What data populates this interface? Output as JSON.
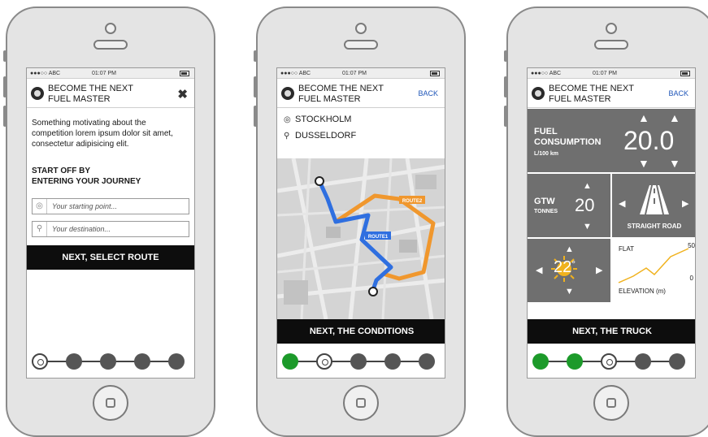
{
  "statusbar": {
    "signal": "●●●○○ ABC",
    "time": "01:07 PM"
  },
  "common": {
    "title_line1": "BECOME THE NEXT",
    "title_line2": "FUEL MASTER",
    "back": "BACK",
    "close": "✖"
  },
  "screen1": {
    "motivation": "Something motivating about the competition lorem ipsum dolor sit amet, consectetur adipisicing elit.",
    "startoff_line1": "START OFF BY",
    "startoff_line2": "ENTERING YOUR JOURNEY",
    "start_placeholder": "Your starting point...",
    "dest_placeholder": "Your destination...",
    "cta": "NEXT, SELECT ROUTE",
    "steps": [
      "current",
      "inactive",
      "inactive",
      "inactive",
      "inactive"
    ]
  },
  "screen2": {
    "from": "STOCKHOLM",
    "to": "DUSSELDORF",
    "route1": "ROUTE1",
    "route2": "ROUTE2",
    "cta": "NEXT, THE CONDITIONS",
    "steps": [
      "done",
      "current",
      "inactive",
      "inactive",
      "inactive"
    ]
  },
  "screen3": {
    "fuel_label1": "FUEL",
    "fuel_label2": "CONSUMPTION",
    "fuel_unit": "L/100 km",
    "fuel_value": "20.0",
    "gtw_label": "GTW",
    "gtw_unit": "TONNES",
    "gtw_value": "20",
    "road_label": "STRAIGHT ROAD",
    "temp_value": "22",
    "temp_unit": "°",
    "flat_label": "FLAT",
    "elev_max": "50",
    "elev_min": "0",
    "elev_label": "ELEVATION",
    "elev_unit": "(m)",
    "cta": "NEXT, THE TRUCK",
    "steps": [
      "done",
      "done",
      "current",
      "inactive",
      "inactive"
    ]
  },
  "colors": {
    "green": "#1c9a2a",
    "route1": "#2f6fe0",
    "route2": "#f0972d",
    "cta": "#0d0d0d",
    "tile": "#6f6f6f"
  },
  "icons": [
    "close-icon",
    "target-icon",
    "pin-icon",
    "logo-icon",
    "arrow-up-icon",
    "arrow-down-icon",
    "road-icon",
    "sun-icon"
  ]
}
